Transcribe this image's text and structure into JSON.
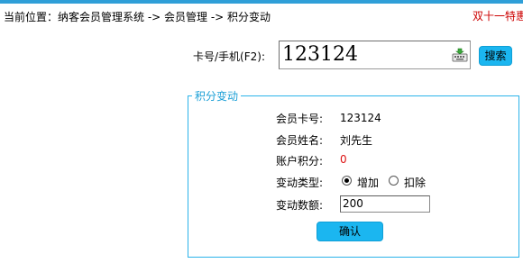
{
  "breadcrumb": "当前位置：纳客会员管理系统 -> 会员管理 -> 积分变动",
  "promo": "双十一特惠",
  "card": {
    "label": "卡号/手机(F2):",
    "value": "123124",
    "keyboard_icon": "keyboard-icon",
    "search_label": "搜索"
  },
  "panel": {
    "legend": "积分变动",
    "member_no_label": "会员卡号:",
    "member_no": "123124",
    "member_name_label": "会员姓名:",
    "member_name": "刘先生",
    "points_label": "账户积分:",
    "points": "0",
    "change_type_label": "变动类型:",
    "change_types": [
      "增加",
      "扣除"
    ],
    "selected_type": "增加",
    "amount_label": "变动数额:",
    "amount": "200",
    "confirm_label": "确认"
  },
  "colors": {
    "accent": "#1bb6f0",
    "border": "#2bb3ea",
    "alert": "#cc0000"
  }
}
